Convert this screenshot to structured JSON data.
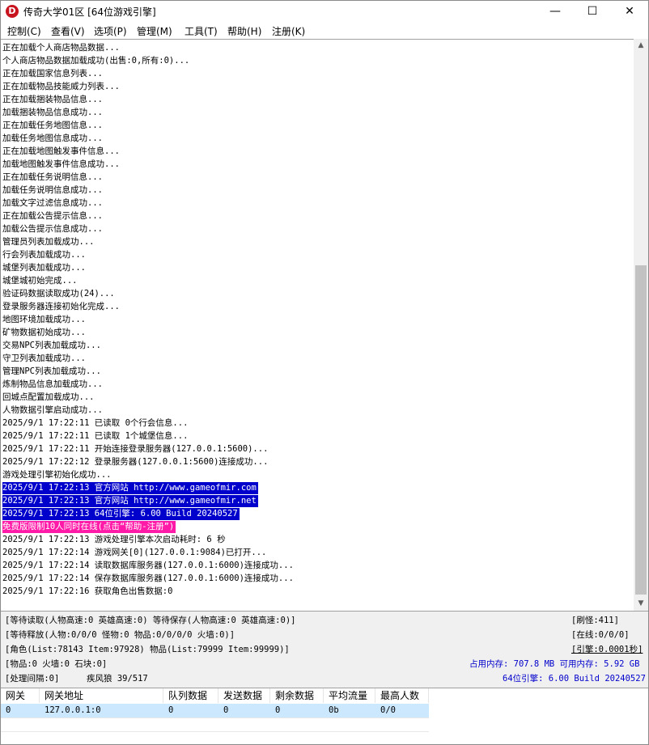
{
  "window": {
    "icon_letter": "D",
    "title": "传奇大学01区 [64位游戏引擎]",
    "minimize": "—",
    "maximize": "☐",
    "close": "✕"
  },
  "menu": [
    "控制(C)",
    "查看(V)",
    "选项(P)",
    "管理(M)",
    "工具(T)",
    "帮助(H)",
    "注册(K)"
  ],
  "log_lines": [
    "正在加载个人商店物品数据...",
    "个人商店物品数据加载成功(出售:0,所有:0)...",
    "正在加载国家信息列表...",
    "正在加载物品技能威力列表...",
    "正在加载捆装物品信息...",
    "加载捆装物品信息成功...",
    "正在加载任务地图信息...",
    "加载任务地图信息成功...",
    "正在加载地图触发事件信息...",
    "加载地图触发事件信息成功...",
    "正在加载任务说明信息...",
    "加载任务说明信息成功...",
    "加载文字过滤信息成功...",
    "正在加载公告提示信息...",
    "加载公告提示信息成功...",
    "管理员列表加载成功...",
    "行会列表加载成功...",
    "城堡列表加载成功...",
    "城堡城初始完成...",
    "验证码数据读取成功(24)...",
    "登录服务器连接初始化完成...",
    "地图环境加载成功...",
    "矿物数据初始成功...",
    "交易NPC列表加载成功...",
    "守卫列表加载成功...",
    "管理NPC列表加载成功...",
    "炼制物品信息加载成功...",
    "回城点配置加载成功...",
    "人物数据引擎启动成功...",
    "2025/9/1 17:22:11 已读取 0个行会信息...",
    "2025/9/1 17:22:11 已读取 1个城堡信息...",
    "2025/9/1 17:22:11 开始连接登录服务器(127.0.0.1:5600)...",
    "2025/9/1 17:22:12 登录服务器(127.0.0.1:5600)连接成功...",
    "游戏处理引擎初始化成功...",
    "2025/9/1 17:22:13 官方网站 http://www.gameofmir.com",
    "2025/9/1 17:22:13 官方网站 http://www.gameofmir.net",
    "2025/9/1 17:22:13 64位引擎: 6.00 Build 20240527",
    "免费版限制10人同时在线(点击“帮助-注册”)",
    "2025/9/1 17:22:13 游戏处理引擎本次启动耗时: 6 秒",
    "2025/9/1 17:22:14 游戏网关[0](127.0.0.1:9084)已打开...",
    "2025/9/1 17:22:14 读取数据库服务器(127.0.0.1:6000)连接成功...",
    "2025/9/1 17:22:14 保存数据库服务器(127.0.0.1:6000)连接成功...",
    "2025/9/1 17:22:16 获取角色出售数据:0"
  ],
  "status": {
    "row1_left": "[等待读取(人物高速:0 英雄高速:0) 等待保存(人物高速:0 英雄高速:0)]",
    "row1_right": "[刷怪:411]",
    "row2_left": "[等待释放(人物:0/0/0 怪物:0 物品:0/0/0/0 火墙:0)]",
    "row2_right": "[在线:0/0/0]",
    "row3_left": "[角色(List:78143 Item:97928) 物品(List:79999 Item:99999)]",
    "row3_right": "[引擎:0.0001秒]",
    "row4_left": "[物品:0 火墙:0 石块:0]",
    "row4_right": "占用内存: 707.8 MB 可用内存: 5.92 GB",
    "row5_left": "[处理间隔:0]",
    "row5_mid": "疾风狼 39/517",
    "row5_right": "64位引擎: 6.00 Build 20240527"
  },
  "gateway_table": {
    "headers": [
      "网关",
      "网关地址",
      "队列数据",
      "发送数据",
      "剩余数据",
      "平均流量",
      "最高人数"
    ],
    "rows": [
      [
        "0",
        "127.0.0.1:0",
        "0",
        "0",
        "0",
        "0b",
        "0/0"
      ]
    ]
  },
  "colors": {
    "highlight_blue": "#0000cc",
    "highlight_pink": "#ff1aa8",
    "selection": "#cce8ff",
    "app_icon": "#c8141e"
  }
}
